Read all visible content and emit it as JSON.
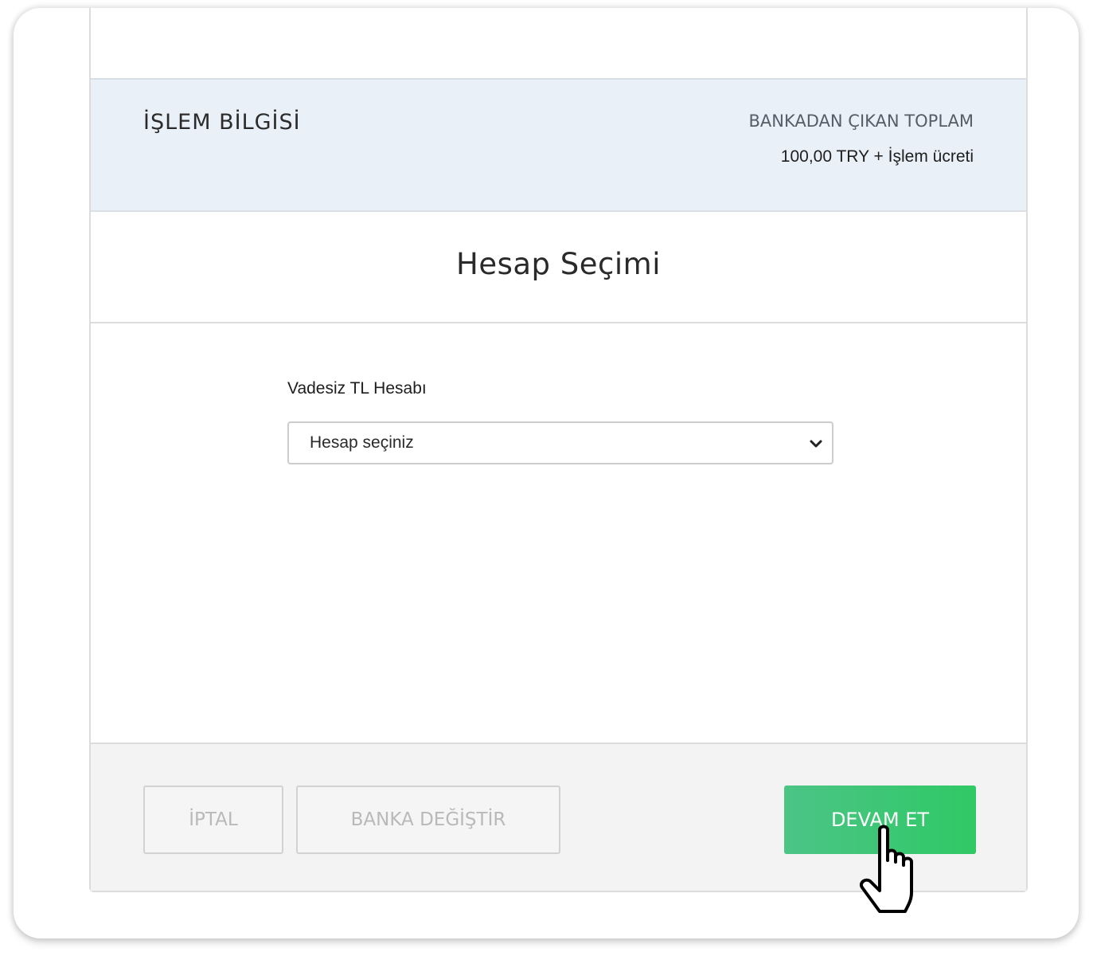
{
  "info": {
    "title": "İŞLEM BİLGİSİ",
    "total_label": "BANKADAN ÇIKAN TOPLAM",
    "total_value": "100,00 TRY + İşlem ücreti"
  },
  "section": {
    "title": "Hesap Seçimi"
  },
  "account_field": {
    "label": "Vadesiz TL Hesabı",
    "selected": "Hesap seçiniz"
  },
  "footer": {
    "cancel_label": "İPTAL",
    "change_bank_label": "BANKA DEĞİŞTİR",
    "continue_label": "DEVAM ET"
  },
  "colors": {
    "primary_button": "#34c76c",
    "info_band": "#eaf0f8",
    "footer_bg": "#f3f3f3"
  },
  "icons": {
    "select_arrow": "chevron-down-icon",
    "pointer": "hand-pointer-cursor-icon"
  }
}
